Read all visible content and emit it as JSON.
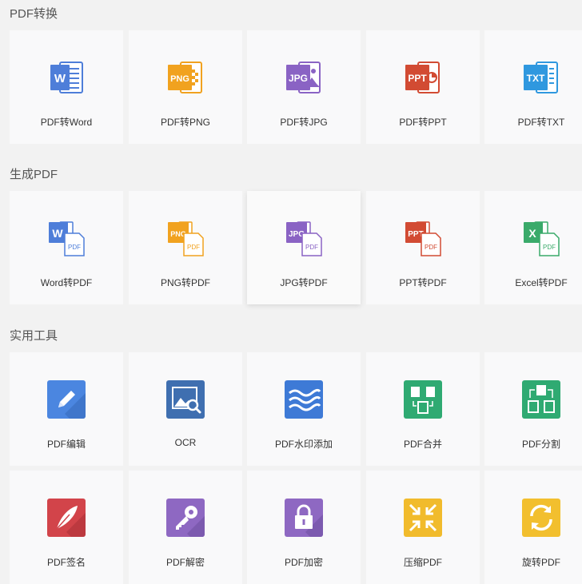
{
  "sections": [
    {
      "title": "PDF转换",
      "items": [
        {
          "label": "PDF转Word",
          "icon": "word-doc-icon"
        },
        {
          "label": "PDF转PNG",
          "icon": "png-image-icon"
        },
        {
          "label": "PDF转JPG",
          "icon": "jpg-image-icon"
        },
        {
          "label": "PDF转PPT",
          "icon": "ppt-slides-icon"
        },
        {
          "label": "PDF转TXT",
          "icon": "txt-text-icon"
        }
      ]
    },
    {
      "title": "生成PDF",
      "items": [
        {
          "label": "Word转PDF",
          "icon": "word-to-pdf-icon"
        },
        {
          "label": "PNG转PDF",
          "icon": "png-to-pdf-icon"
        },
        {
          "label": "JPG转PDF",
          "icon": "jpg-to-pdf-icon"
        },
        {
          "label": "PPT转PDF",
          "icon": "ppt-to-pdf-icon"
        },
        {
          "label": "Excel转PDF",
          "icon": "excel-to-pdf-icon"
        }
      ]
    },
    {
      "title": "实用工具",
      "items": [
        {
          "label": "PDF编辑",
          "icon": "pencil-edit-icon"
        },
        {
          "label": "OCR",
          "icon": "image-search-icon"
        },
        {
          "label": "PDF水印添加",
          "icon": "watermark-waves-icon"
        },
        {
          "label": "PDF合并",
          "icon": "merge-icon"
        },
        {
          "label": "PDF分割",
          "icon": "split-icon"
        },
        {
          "label": "PDF签名",
          "icon": "feather-pen-icon"
        },
        {
          "label": "PDF解密",
          "icon": "key-icon"
        },
        {
          "label": "PDF加密",
          "icon": "lock-icon"
        },
        {
          "label": "压缩PDF",
          "icon": "compress-arrows-icon"
        },
        {
          "label": "旋转PDF",
          "icon": "rotate-arrows-icon"
        }
      ]
    }
  ],
  "badges": {
    "word": "W",
    "png": "PNG",
    "jpg": "JPG",
    "ppt": "PPT",
    "txt": "TXT",
    "excel": "X",
    "pdf": "PDF"
  },
  "colors": {
    "word": "#4e7ed9",
    "png": "#f1a21f",
    "jpg": "#8a63c4",
    "ppt": "#d24b33",
    "txt": "#2f98df",
    "excel": "#3aaa6a",
    "edit": "#4b86e0",
    "ocr": "#3f6fb0",
    "watermark": "#3e7ad6",
    "merge": "#2faa72",
    "split": "#2faa72",
    "sign": "#d2444a",
    "decrypt": "#8e68c2",
    "encrypt": "#8e68c2",
    "compress": "#f1bb2c",
    "rotate": "#f2bf2e"
  }
}
